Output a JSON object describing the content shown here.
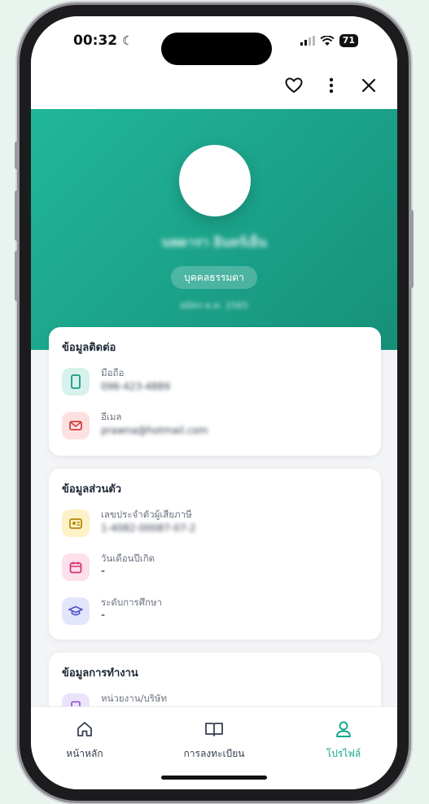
{
  "status_bar": {
    "time": "00:32",
    "battery": "71"
  },
  "profile": {
    "name": "นพดารา อินทร์เย็น",
    "badge": "บุคคลธรรมดา",
    "sub": "สมัคร ต.ค. 2565"
  },
  "sections": {
    "contact": {
      "title": "ข้อมูลติดต่อ",
      "phone_label": "มือถือ",
      "phone_value": "096-423-4889",
      "email_label": "อีเมล",
      "email_value": "prawna@hotmail.com"
    },
    "personal": {
      "title": "ข้อมูลส่วนตัว",
      "tax_label": "เลขประจำตัวผู้เสียภาษี",
      "tax_value": "1-4082-00087-07-2",
      "birthday_label": "วันเดือนปีเกิด",
      "birthday_value": "-",
      "education_label": "ระดับการศึกษา",
      "education_value": "-"
    },
    "work": {
      "title": "ข้อมูลการทำงาน",
      "company_label": "หน่วยงาน/บริษัท"
    }
  },
  "bottom_nav": {
    "home": "หน้าหลัก",
    "registration": "การลงทะเบียน",
    "profile": "โปรไฟล์"
  },
  "colors": {
    "accent": "#17a88c",
    "header_start": "#20b79a",
    "header_end": "#169078"
  },
  "icons": {
    "favorite": "heart-icon",
    "more": "more-vertical-icon",
    "close": "close-icon",
    "phone": "phone-icon",
    "email": "mail-icon",
    "tax": "id-card-icon",
    "birthday": "calendar-icon",
    "education": "graduation-cap-icon",
    "company": "building-icon",
    "home": "home-icon",
    "registration": "book-icon",
    "profile": "user-icon"
  }
}
